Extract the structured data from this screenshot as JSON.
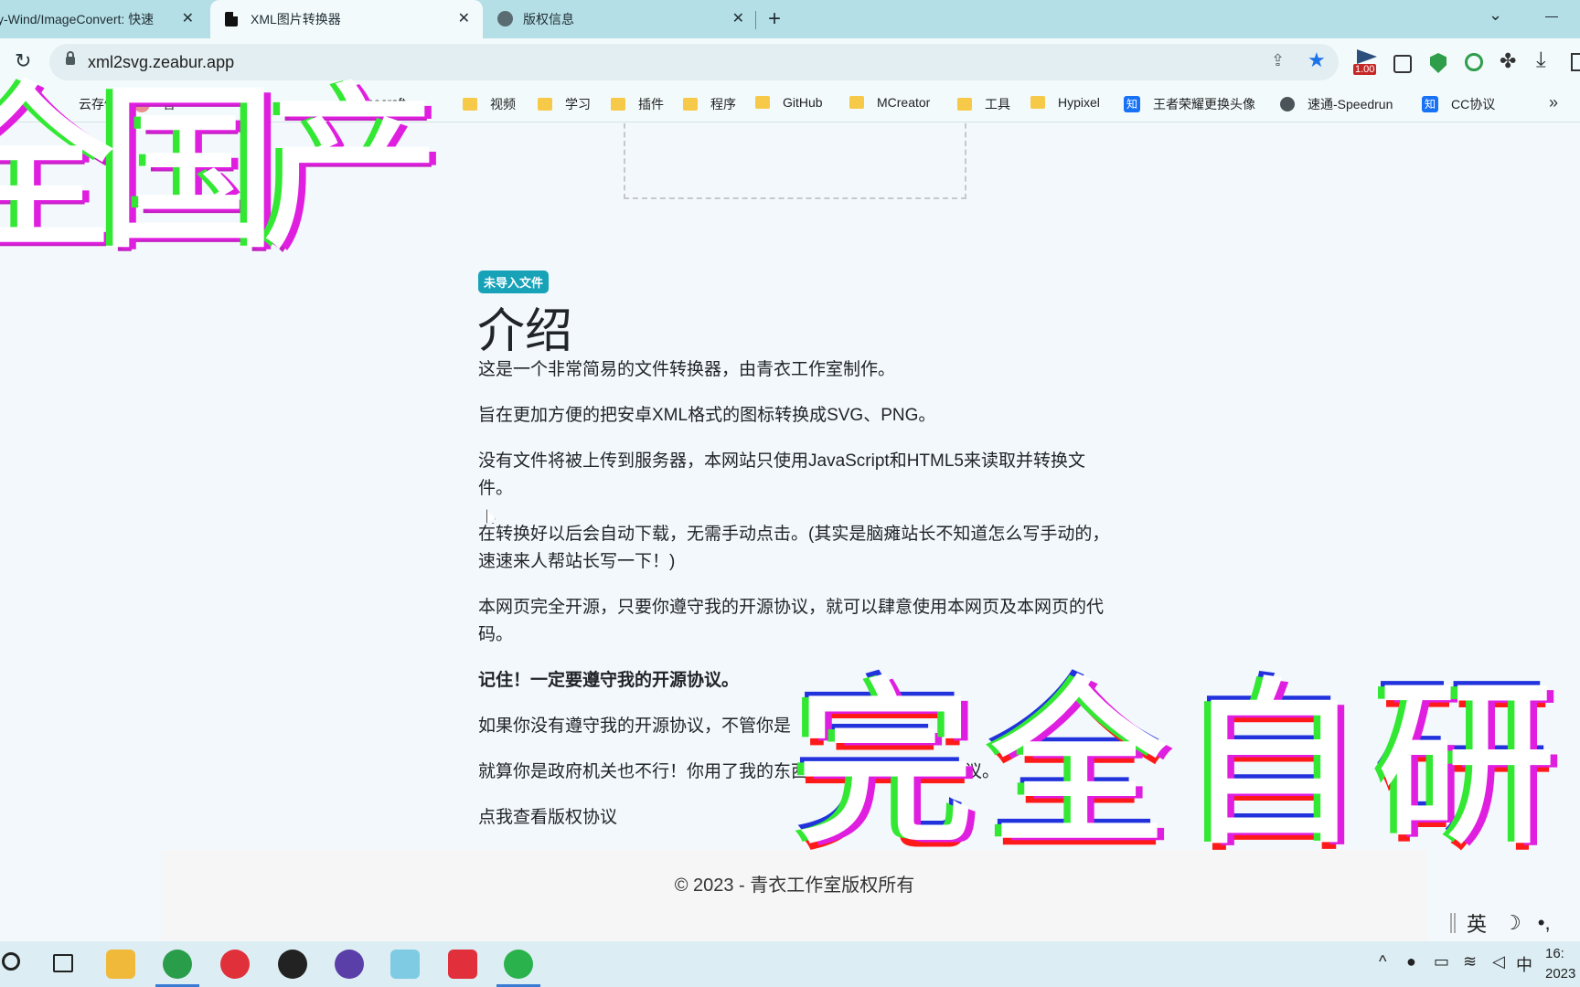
{
  "tabs": [
    {
      "title": "y-Wind/ImageConvert: 快速",
      "active": false
    },
    {
      "title": "XML图片转换器",
      "active": true
    },
    {
      "title": "版权信息",
      "active": false
    }
  ],
  "toolbar": {
    "url": "xml2svg.zeabur.app",
    "speed_badge": "1.00"
  },
  "bookmarks": [
    {
      "label": "云存储",
      "icon": "orange-icon"
    },
    {
      "label": "音",
      "icon": "redcirc-icon"
    },
    {
      "label": "Minecraft",
      "icon": "folder-icon"
    },
    {
      "label": "视频",
      "icon": "folder-icon"
    },
    {
      "label": "学习",
      "icon": "folder-icon"
    },
    {
      "label": "插件",
      "icon": "folder-icon"
    },
    {
      "label": "程序",
      "icon": "folder-icon"
    },
    {
      "label": "GitHub",
      "icon": "folder-icon"
    },
    {
      "label": "MCreator",
      "icon": "folder-icon"
    },
    {
      "label": "工具",
      "icon": "folder-icon"
    },
    {
      "label": "Hypixel",
      "icon": "folder-icon"
    },
    {
      "label": "王者荣耀更换头像",
      "icon": "zhihu-icon"
    },
    {
      "label": "速通-Speedrun",
      "icon": "globe-icon"
    },
    {
      "label": "CC协议",
      "icon": "zhihu-icon"
    }
  ],
  "bookmarks_more": "»",
  "page": {
    "status_badge": "未导入文件",
    "heading": "介绍",
    "paragraphs": [
      "这是一个非常简易的文件转换器，由青衣工作室制作。",
      "旨在更加方便的把安卓XML格式的图标转换成SVG、PNG。",
      "没有文件将被上传到服务器，本网站只使用JavaScript和HTML5来读取并转换文件。",
      "在转换好以后会自动下载，无需手动点击。(其实是脑瘫站长不知道怎么写手动的，速速来人帮站长写一下！)",
      "本网页完全开源，只要你遵守我的开源协议，就可以肆意使用本网页及本网页的代码。",
      "记住！一定要遵守我的开源协议。",
      "如果你没有遵守我的开源协议，不管你是",
      "就算你是政府机关也不行！你用了我的东西就要遵守我的版权协议。",
      "点我查看版权协议"
    ],
    "footer": "© 2023 - 青衣工作室版权所有"
  },
  "overlay": {
    "top_text": "全国产",
    "bottom_text": "完全自研"
  },
  "ime": {
    "lang": "英",
    "moon": "☽",
    "punct": "•,"
  },
  "taskbar": {
    "tray_input": "中",
    "time": "16:",
    "date": "2023"
  },
  "colors": {
    "tabbar": "#b5dfe6",
    "badge": "#17a2b8",
    "page_bg": "#f2f8fb",
    "footer_bg": "#f6f6f7"
  }
}
